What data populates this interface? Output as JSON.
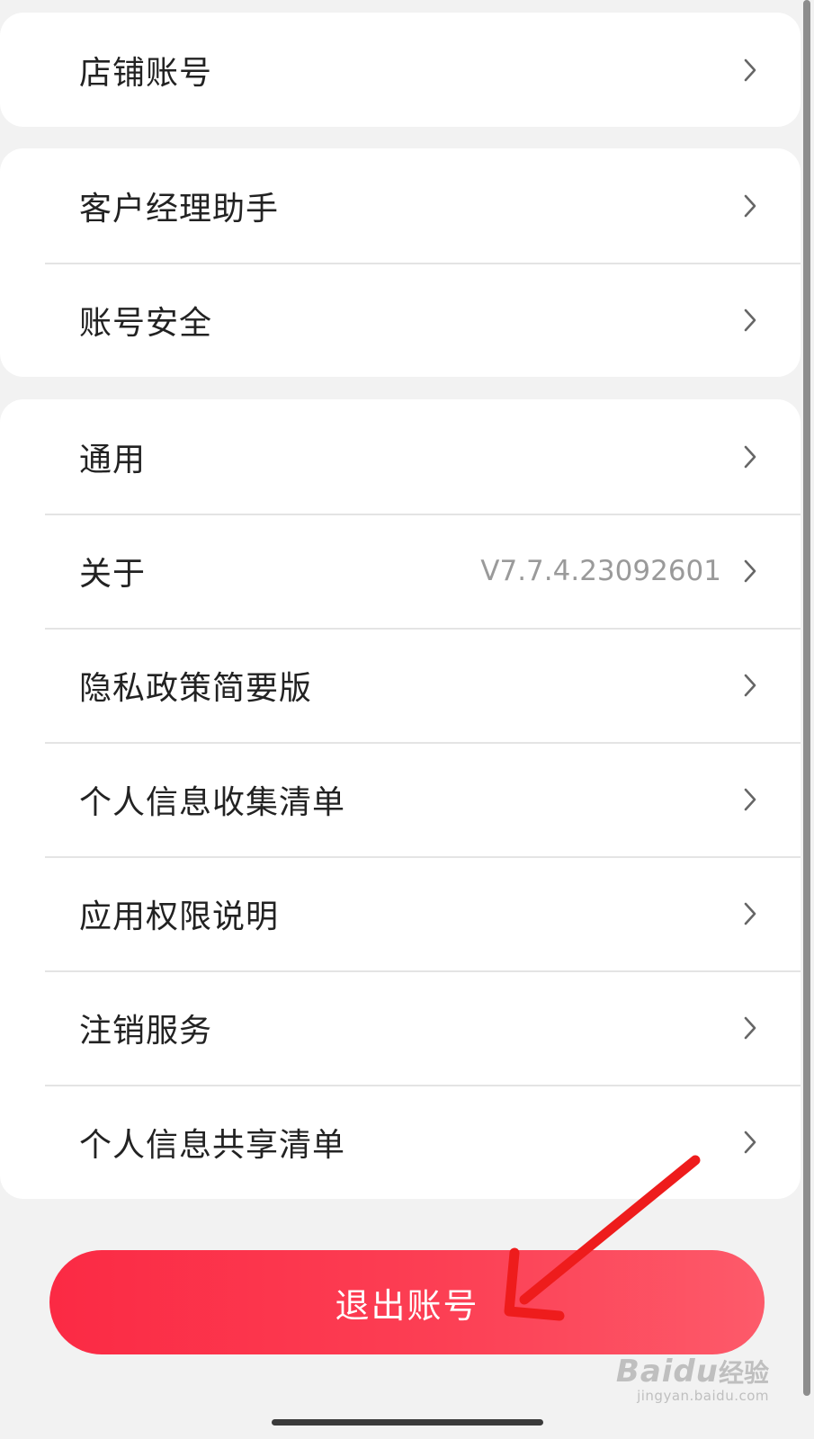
{
  "groups": [
    {
      "items": [
        {
          "label": "店铺账号",
          "value": ""
        }
      ]
    },
    {
      "items": [
        {
          "label": "客户经理助手",
          "value": ""
        },
        {
          "label": "账号安全",
          "value": ""
        }
      ]
    },
    {
      "items": [
        {
          "label": "通用",
          "value": ""
        },
        {
          "label": "关于",
          "value": "V7.7.4.23092601"
        },
        {
          "label": "隐私政策简要版",
          "value": ""
        },
        {
          "label": "个人信息收集清单",
          "value": ""
        },
        {
          "label": "应用权限说明",
          "value": ""
        },
        {
          "label": "注销服务",
          "value": ""
        },
        {
          "label": "个人信息共享清单",
          "value": ""
        }
      ]
    }
  ],
  "logout": {
    "label": "退出账号"
  },
  "watermark": {
    "brand": "Baidu",
    "brand_cn": "经验",
    "url": "jingyan.baidu.com"
  },
  "icons": {
    "row_arrow": "chevron-right-icon",
    "annotation": "red-arrow-icon"
  },
  "colors": {
    "accent_red": "#fb2a44",
    "annotation_red": "#ee1c1c"
  }
}
